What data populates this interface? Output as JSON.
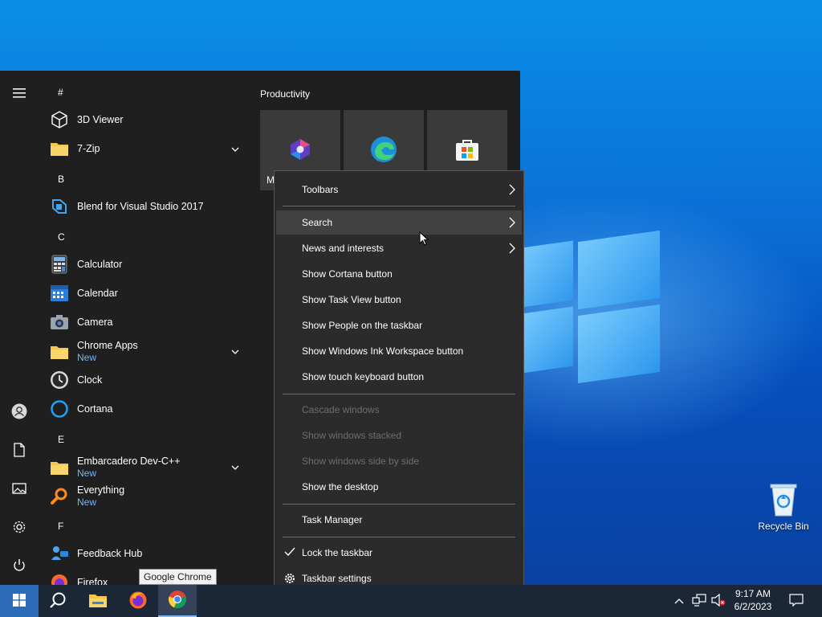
{
  "start_menu": {
    "sections": [
      {
        "letter": "#"
      },
      {
        "letter": "B"
      },
      {
        "letter": "C"
      },
      {
        "letter": "E"
      },
      {
        "letter": "F"
      }
    ],
    "apps": [
      {
        "name": "3D Viewer",
        "icon": "cube-icon"
      },
      {
        "name": "7-Zip",
        "icon": "folder-icon",
        "expandable": true
      },
      {
        "name": "Blend for Visual Studio 2017",
        "icon": "blend-icon"
      },
      {
        "name": "Calculator",
        "icon": "calculator-icon"
      },
      {
        "name": "Calendar",
        "icon": "calendar-icon"
      },
      {
        "name": "Camera",
        "icon": "camera-icon"
      },
      {
        "name": "Chrome Apps",
        "icon": "folder-icon",
        "badge": "New",
        "expandable": true
      },
      {
        "name": "Clock",
        "icon": "clock-icon"
      },
      {
        "name": "Cortana",
        "icon": "cortana-icon"
      },
      {
        "name": "Embarcadero Dev-C++",
        "icon": "folder-icon",
        "badge": "New",
        "expandable": true
      },
      {
        "name": "Everything",
        "icon": "magnifier-icon",
        "badge": "New"
      },
      {
        "name": "Feedback Hub",
        "icon": "feedback-icon"
      },
      {
        "name": "Firefox",
        "icon": "firefox-icon"
      }
    ],
    "rail": [
      "hamburger-icon",
      "user-icon",
      "document-icon",
      "pictures-icon",
      "settings-icon",
      "power-icon"
    ],
    "tiles": {
      "group_title": "Productivity",
      "items": [
        {
          "icon": "office-icon",
          "label": "M"
        },
        {
          "icon": "edge-icon",
          "label": ""
        },
        {
          "icon": "store-icon",
          "label": ""
        }
      ]
    }
  },
  "context_menu": {
    "items": [
      {
        "label": "Toolbars",
        "submenu": true
      },
      {
        "label": "Search",
        "submenu": true,
        "hovered": true
      },
      {
        "label": "News and interests",
        "submenu": true
      },
      {
        "label": "Show Cortana button"
      },
      {
        "label": "Show Task View button"
      },
      {
        "label": "Show People on the taskbar"
      },
      {
        "label": "Show Windows Ink Workspace button"
      },
      {
        "label": "Show touch keyboard button"
      },
      {
        "label": "Cascade windows",
        "disabled": true
      },
      {
        "label": "Show windows stacked",
        "disabled": true
      },
      {
        "label": "Show windows side by side",
        "disabled": true
      },
      {
        "label": "Show the desktop"
      },
      {
        "label": "Task Manager"
      },
      {
        "label": "Lock the taskbar",
        "checked": true
      },
      {
        "label": "Taskbar settings",
        "icon": "gear-icon"
      }
    ]
  },
  "tooltip": "Google Chrome",
  "desktop": {
    "recycle_bin_label": "Recycle Bin"
  },
  "taskbar": {
    "pinned": [
      "windows-start-icon",
      "search-icon",
      "file-explorer-icon",
      "firefox-icon",
      "chrome-icon"
    ],
    "tray": {
      "time": "9:17 AM",
      "date": "6/2/2023"
    }
  }
}
